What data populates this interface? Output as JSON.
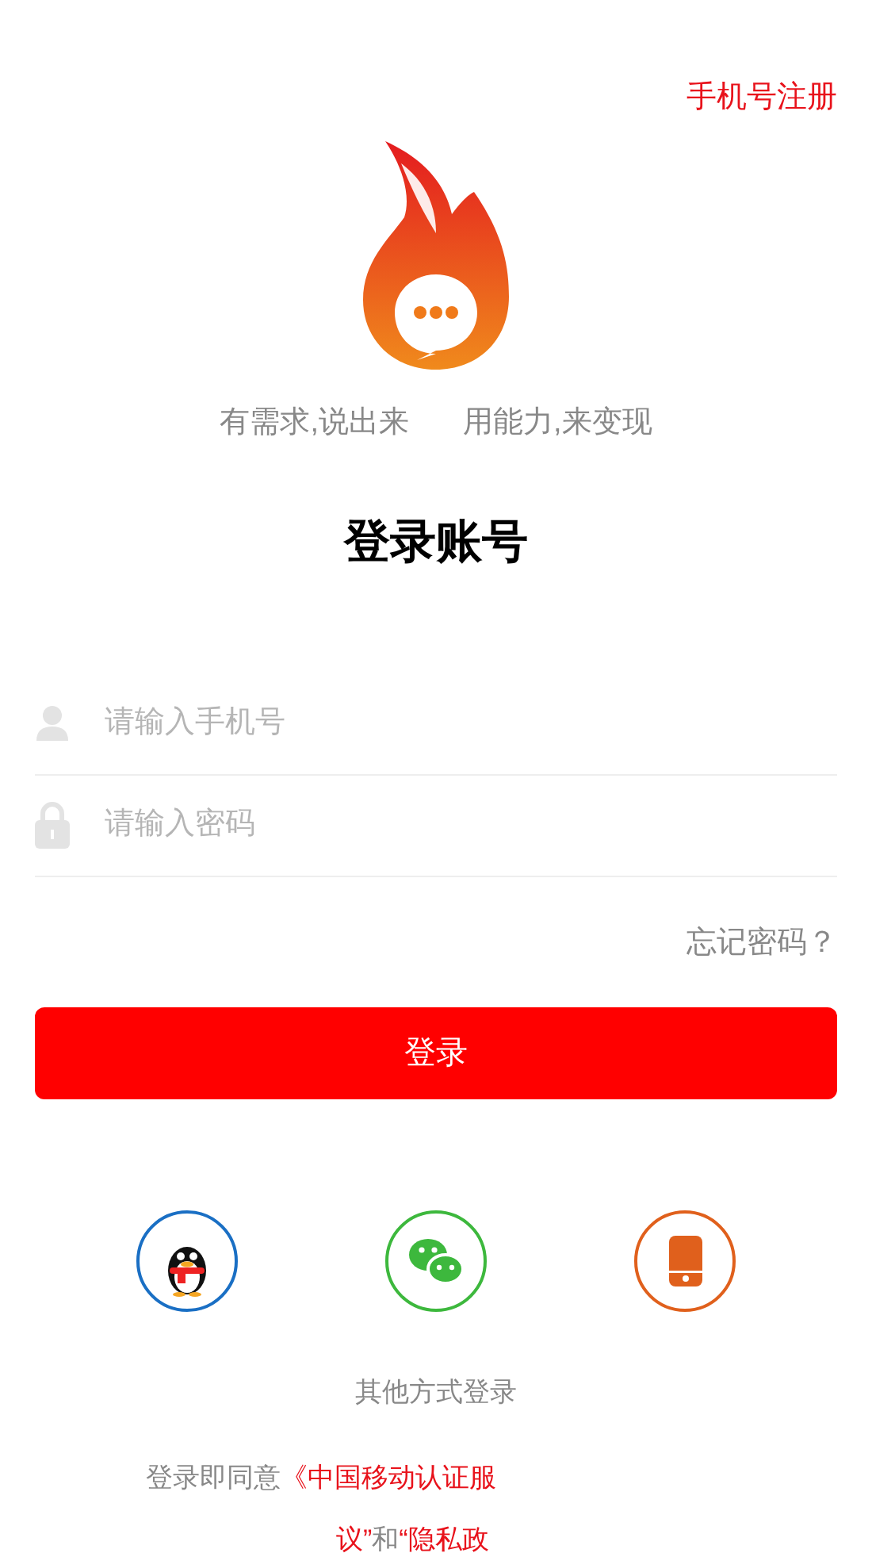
{
  "register_link": "手机号注册",
  "slogan": [
    "有需求,说出来",
    "用能力,来变现"
  ],
  "title": "登录账号",
  "fields": [
    {
      "kind": "phone",
      "placeholder": "请输入手机号"
    },
    {
      "kind": "password",
      "placeholder": "请输入密码"
    }
  ],
  "forgot_link": "忘记密码？",
  "login_button": "登录",
  "social_logins": [
    {
      "kind": "qq",
      "color": "#1a6fc4"
    },
    {
      "kind": "wechat",
      "color": "#3db83d"
    },
    {
      "kind": "phone",
      "color": "#e0601c"
    }
  ],
  "other_methods": "其他方式登录",
  "agreement_lines": [
    [
      {
        "kind": "text",
        "text": "登录即同意"
      },
      {
        "kind": "link",
        "text": "《中国移动认证服"
      }
    ],
    [
      {
        "kind": "link",
        "text": "议”"
      },
      {
        "kind": "text",
        "text": "和"
      },
      {
        "kind": "link",
        "text": "“隐私政"
      }
    ]
  ]
}
